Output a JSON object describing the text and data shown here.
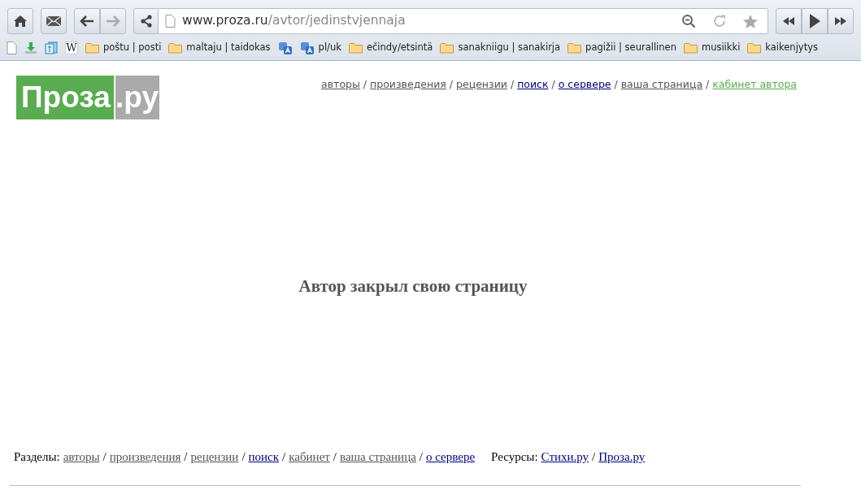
{
  "browser": {
    "url_host": "www.proza.ru",
    "url_path": "/avtor/jedinstvjennaja",
    "forward_disabled": true,
    "bookmarks": [
      {
        "kind": "page"
      },
      {
        "kind": "download"
      },
      {
        "kind": "books"
      },
      {
        "kind": "wiki",
        "label": "W"
      },
      {
        "kind": "folder",
        "label": "poštu | posti"
      },
      {
        "kind": "folder",
        "label": "maltaju | taidokas"
      },
      {
        "kind": "translate"
      },
      {
        "kind": "translate",
        "label": "pl/uk"
      },
      {
        "kind": "folder",
        "label": "ečindy/etsintä"
      },
      {
        "kind": "folder",
        "label": "sanakniigu | sanakirja"
      },
      {
        "kind": "folder",
        "label": "pagižii | seurallinen"
      },
      {
        "kind": "folder",
        "label": "musiikki"
      },
      {
        "kind": "folder",
        "label": "kaikenjytys"
      }
    ]
  },
  "site": {
    "logo_main": "Проза",
    "logo_suffix": ".ру",
    "top_nav": [
      {
        "kind": "link",
        "text": "авторы",
        "color": "#555555"
      },
      {
        "kind": "sep",
        "text": "/"
      },
      {
        "kind": "link",
        "text": "произведения",
        "color": "#555555"
      },
      {
        "kind": "sep",
        "text": "/"
      },
      {
        "kind": "link",
        "text": "рецензии",
        "color": "#555555"
      },
      {
        "kind": "sep",
        "text": "/"
      },
      {
        "kind": "link",
        "text": "поиск",
        "color": "#000080"
      },
      {
        "kind": "sep",
        "text": "/"
      },
      {
        "kind": "link",
        "text": "о сервере",
        "color": "#000080"
      },
      {
        "kind": "sep",
        "text": "/"
      },
      {
        "kind": "link",
        "text": "ваша страница",
        "color": "#555555"
      },
      {
        "kind": "sep",
        "text": "/"
      },
      {
        "kind": "link",
        "text": "кабинет автора",
        "color": "#5aac50"
      }
    ],
    "message": "Автор закрыл свою страницу",
    "footer": [
      {
        "kind": "label",
        "text": "Разделы:"
      },
      {
        "kind": "link",
        "text": "авторы",
        "color": "#555555"
      },
      {
        "kind": "sep",
        "text": "/"
      },
      {
        "kind": "link",
        "text": "произведения",
        "color": "#555555"
      },
      {
        "kind": "sep",
        "text": "/"
      },
      {
        "kind": "link",
        "text": "рецензии",
        "color": "#555555"
      },
      {
        "kind": "sep",
        "text": "/"
      },
      {
        "kind": "link",
        "text": "поиск",
        "color": "#000080"
      },
      {
        "kind": "sep",
        "text": "/"
      },
      {
        "kind": "link",
        "text": "кабинет",
        "color": "#555555"
      },
      {
        "kind": "sep",
        "text": "/"
      },
      {
        "kind": "link",
        "text": "ваша страница",
        "color": "#555555"
      },
      {
        "kind": "sep",
        "text": "/"
      },
      {
        "kind": "link",
        "text": "о сервере",
        "color": "#000080"
      },
      {
        "kind": "label",
        "text": "Ресурсы:"
      },
      {
        "kind": "link",
        "text": "Стихи.ру",
        "color": "#000080"
      },
      {
        "kind": "sep",
        "text": "/"
      },
      {
        "kind": "link",
        "text": "Проза.ру",
        "color": "#000080"
      }
    ]
  }
}
